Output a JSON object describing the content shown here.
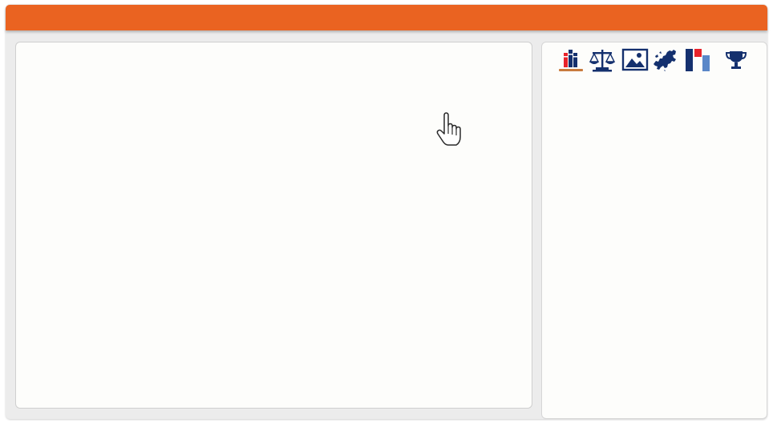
{
  "colors": {
    "header": "#ea6321",
    "panel_background": "#fdfdfb",
    "frame_background": "#ececec",
    "icon_navy": "#14306e",
    "icon_red": "#e8222a",
    "icon_blue": "#5a87c8",
    "icon_underline": "#c97b3e"
  },
  "toolbar": {
    "icons": [
      {
        "name": "books-icon",
        "selected": true
      },
      {
        "name": "scales-icon",
        "selected": false
      },
      {
        "name": "image-icon",
        "selected": false
      },
      {
        "name": "europe-map-icon",
        "selected": false
      },
      {
        "name": "flag-icon",
        "selected": false
      },
      {
        "name": "trophy-icon",
        "selected": false
      }
    ]
  },
  "cursor": {
    "name": "hand-pointer-icon"
  }
}
